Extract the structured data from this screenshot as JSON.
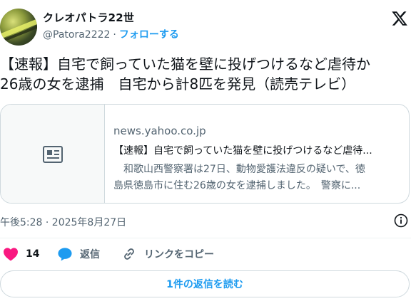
{
  "author": {
    "display_name": "クレオパトラ22世",
    "handle": "@Patora2222",
    "separator": "·",
    "follow_label": "フォローする"
  },
  "tweet": {
    "line1": "【速報】自宅で飼っていた猫を壁に投げつけるなど虐待か",
    "line2": "26歳の女を逮捕　自宅から計8匹を発見（読売テレビ）"
  },
  "card": {
    "domain": "news.yahoo.co.jp",
    "title": "【速報】自宅で飼っていた猫を壁に投げつけるなど虐待...",
    "desc_line1": "　和歌山西警察署は27日、動物愛護法違反の疑いで、徳",
    "desc_line2": "島県徳島市に住む26歳の女を逮捕しました。　警察に..."
  },
  "timestamp": "午後5:28 · 2025年8月27日",
  "actions": {
    "like_count": "14",
    "reply_label": "返信",
    "copy_link_label": "リンクをコピー"
  },
  "read_replies_label": "1件の返信を読む",
  "colors": {
    "accent": "#1d9bf0",
    "like": "#f91880",
    "secondary_text": "#536471",
    "border": "#cfd9de"
  },
  "icons": {
    "brand": "x-logo-icon",
    "card_placeholder": "article-icon",
    "info": "info-icon",
    "like": "heart-icon",
    "reply": "reply-bubble-icon",
    "copy_link": "link-icon"
  }
}
